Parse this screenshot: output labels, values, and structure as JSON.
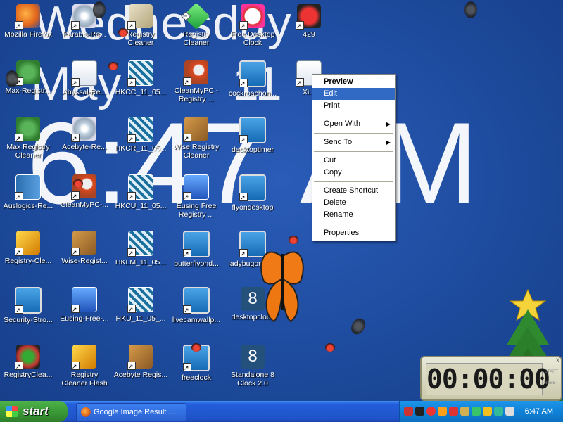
{
  "overlay": {
    "day": "Wednesday",
    "month": "May",
    "date": "11",
    "time": "6:47 AM"
  },
  "icons": [
    {
      "label": "Mozilla Firefox",
      "icon": "firefox-icon"
    },
    {
      "label": "Parabis-Re...",
      "icon": "app-icon"
    },
    {
      "label": "Registry Cleaner",
      "icon": "registry-icon"
    },
    {
      "label": "Registry Cleaner",
      "icon": "green-gem-icon"
    },
    {
      "label": "Free Desktop Clock",
      "icon": "alarm-clock-icon"
    },
    {
      "label": "429",
      "icon": "ladybug-icon"
    },
    {
      "label": "Max-Registr...",
      "icon": "gear-icon"
    },
    {
      "label": "Abyssal-Re...",
      "icon": "document-icon"
    },
    {
      "label": "HKCC_11_05...",
      "icon": "registry-file-icon"
    },
    {
      "label": "CleanMyPC - Registry ...",
      "icon": "magnifier-icon"
    },
    {
      "label": "cockroachon...",
      "icon": "installer-icon"
    },
    {
      "label": "Xi...",
      "icon": "doc-icon"
    },
    {
      "label": "Max Registry Cleaner",
      "icon": "gear-icon"
    },
    {
      "label": "Acebyte-Re...",
      "icon": "cd-icon"
    },
    {
      "label": "HKCR_11_05...",
      "icon": "registry-file-icon"
    },
    {
      "label": "Wise Registry Cleaner",
      "icon": "box-icon"
    },
    {
      "label": "desktoptimer",
      "icon": "installer-icon"
    },
    {
      "label": "Auslogics-Re...",
      "icon": "book-icon"
    },
    {
      "label": "CleanMyPC-...",
      "icon": "magnifier-icon"
    },
    {
      "label": "HKCU_11_05...",
      "icon": "registry-file-icon"
    },
    {
      "label": "Eusing Free Registry ...",
      "icon": "installer-icon"
    },
    {
      "label": "flyondesktop",
      "icon": "installer-icon"
    },
    {
      "label": "Registry-Cle...",
      "icon": "bolt-icon"
    },
    {
      "label": "Wise-Regist...",
      "icon": "box-icon"
    },
    {
      "label": "HKLM_11_05...",
      "icon": "registry-file-icon"
    },
    {
      "label": "butterflyond...",
      "icon": "installer-icon"
    },
    {
      "label": "ladybugonde...",
      "icon": "installer-icon"
    },
    {
      "label": "Security-Stro...",
      "icon": "installer-icon"
    },
    {
      "label": "Eusing-Free-...",
      "icon": "pc-icon"
    },
    {
      "label": "HKU_11_05_...",
      "icon": "registry-file-icon"
    },
    {
      "label": "livecamwallp...",
      "icon": "installer-icon"
    },
    {
      "label": "desktopclock",
      "icon": "tile-8-icon"
    },
    {
      "label": "RegistryClea...",
      "icon": "registry-cleaner-icon"
    },
    {
      "label": "Registry Cleaner Flash",
      "icon": "bolt-icon"
    },
    {
      "label": "Acebyte Regis...",
      "icon": "acebyte-icon"
    },
    {
      "label": "freeclock",
      "icon": "installer-icon"
    },
    {
      "label": "Standalone 8 Clock 2.0",
      "icon": "tile-8-icon"
    }
  ],
  "context_menu": {
    "preview": "Preview",
    "edit": "Edit",
    "print": "Print",
    "open_with": "Open With",
    "send_to": "Send To",
    "cut": "Cut",
    "copy": "Copy",
    "create_shortcut": "Create Shortcut",
    "delete": "Delete",
    "rename": "Rename",
    "properties": "Properties"
  },
  "timer": {
    "display": "00:00:00",
    "side_top": "START",
    "side_bottom": "RESET",
    "close": "x"
  },
  "taskbar": {
    "start_label": "start",
    "task_label": "Google Image Result ...",
    "clock": "6:47 AM"
  },
  "colors": {
    "desktop": "#1f4ea0",
    "taskbar": "#245edb",
    "start": "#3a9a36",
    "highlight": "#316ac5"
  }
}
